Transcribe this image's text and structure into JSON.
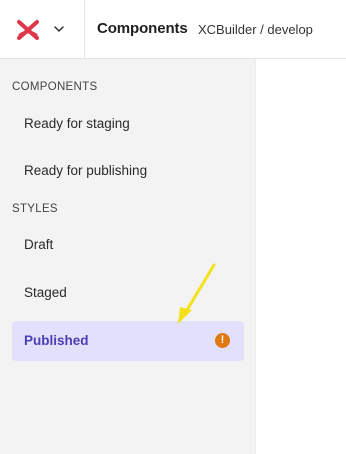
{
  "header": {
    "title": "Components",
    "project": "XCBuilder / develop",
    "logo_icon": "x-logo-icon",
    "menu_icon": "chevron-down-icon",
    "logo_color": "#e0364a"
  },
  "sidebar": {
    "sections": [
      {
        "header": "COMPONENTS",
        "items": [
          {
            "label": "Ready for staging",
            "active": false
          },
          {
            "label": "Ready for publishing",
            "active": false
          }
        ]
      },
      {
        "header": "STYLES",
        "items": [
          {
            "label": "Draft",
            "active": false
          },
          {
            "label": "Staged",
            "active": false
          },
          {
            "label": "Published",
            "active": true,
            "badge": "!"
          }
        ]
      }
    ],
    "active_color": "#4b3fb5",
    "active_bg": "#e3e0fb",
    "badge_color": "#e07912"
  },
  "annotation": {
    "arrow_color": "#f5e11b",
    "icon": "yellow-arrow-annotation"
  }
}
